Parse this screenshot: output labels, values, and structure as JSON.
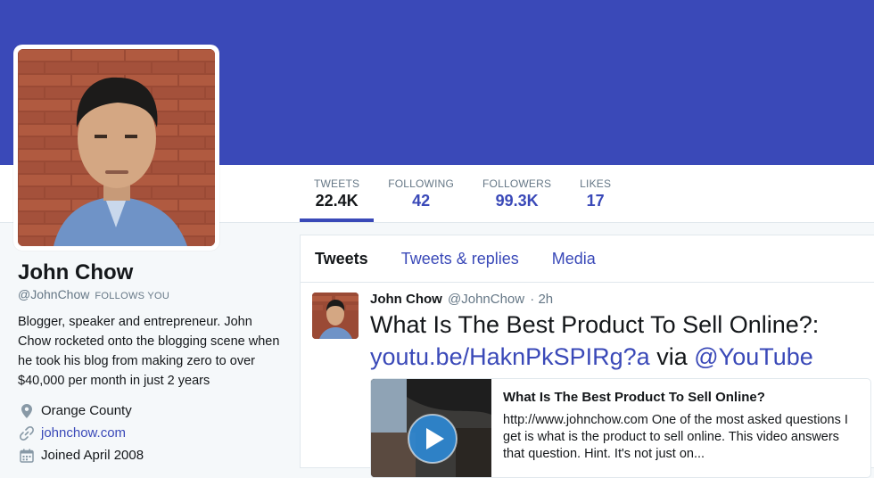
{
  "colors": {
    "accent": "#3a49b8",
    "banner": "#3a49b8",
    "muted": "#657786"
  },
  "stats": [
    {
      "label": "TWEETS",
      "value": "22.4K"
    },
    {
      "label": "FOLLOWING",
      "value": "42"
    },
    {
      "label": "FOLLOWERS",
      "value": "99.3K"
    },
    {
      "label": "LIKES",
      "value": "17"
    }
  ],
  "profile": {
    "name": "John Chow",
    "handle": "@JohnChow",
    "follows_you": "FOLLOWS YOU",
    "bio": "Blogger, speaker and entrepreneur. John Chow rocketed onto the blogging scene when he took his blog from making zero to over $40,000 per month in just 2 years",
    "location": "Orange County",
    "website": "johnchow.com",
    "joined": "Joined April 2008",
    "icons": {
      "location": "location-pin-icon",
      "website": "link-icon",
      "joined": "calendar-icon"
    }
  },
  "tabs": [
    {
      "label": "Tweets"
    },
    {
      "label": "Tweets & replies"
    },
    {
      "label": "Media"
    }
  ],
  "tweet": {
    "name": "John Chow",
    "handle": "@JohnChow",
    "time": "· 2h",
    "text_plain": "What Is The Best Product To Sell Online?:",
    "link": "youtu.be/HaknPkSPIRg?a",
    "via": "via",
    "mention": "@YouTube",
    "card": {
      "title": "What Is The Best Product To Sell Online?",
      "description": "http://www.johnchow.com One of the most asked questions I get is what is the product to sell online. This video answers that question. Hint. It's not just on..."
    }
  }
}
